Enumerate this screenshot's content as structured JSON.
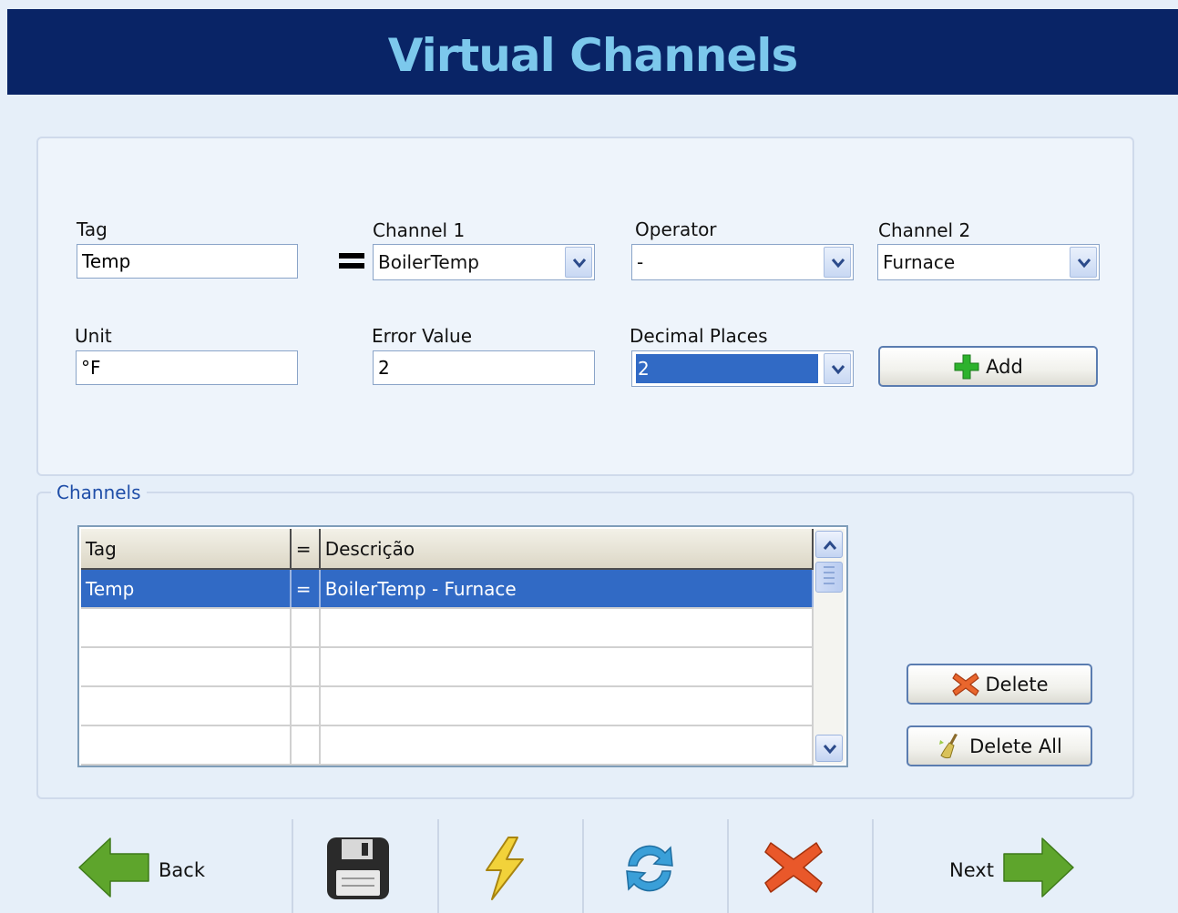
{
  "header": {
    "title": "Virtual Channels"
  },
  "form": {
    "tag_label": "Tag",
    "tag_value": "Temp",
    "channel1_label": "Channel 1",
    "channel1_value": "BoilerTemp",
    "operator_label": "Operator",
    "operator_value": "-",
    "channel2_label": "Channel 2",
    "channel2_value": "Furnace",
    "unit_label": "Unit",
    "unit_value": "°F",
    "error_label": "Error Value",
    "error_value": "2",
    "decimal_label": "Decimal Places",
    "decimal_value": "2",
    "add_label": "Add"
  },
  "channels": {
    "group_title": "Channels",
    "columns": [
      "Tag",
      "=",
      "Descrição"
    ],
    "rows": [
      {
        "tag": "Temp",
        "eq": "=",
        "desc": "BoilerTemp - Furnace"
      }
    ],
    "delete_label": "Delete",
    "delete_all_label": "Delete All"
  },
  "footer": {
    "back_label": "Back",
    "next_label": "Next"
  },
  "colors": {
    "header_bg": "#092466",
    "title_color": "#7cc8ec",
    "selection": "#316ac5",
    "group_title": "#1f4ea8"
  }
}
